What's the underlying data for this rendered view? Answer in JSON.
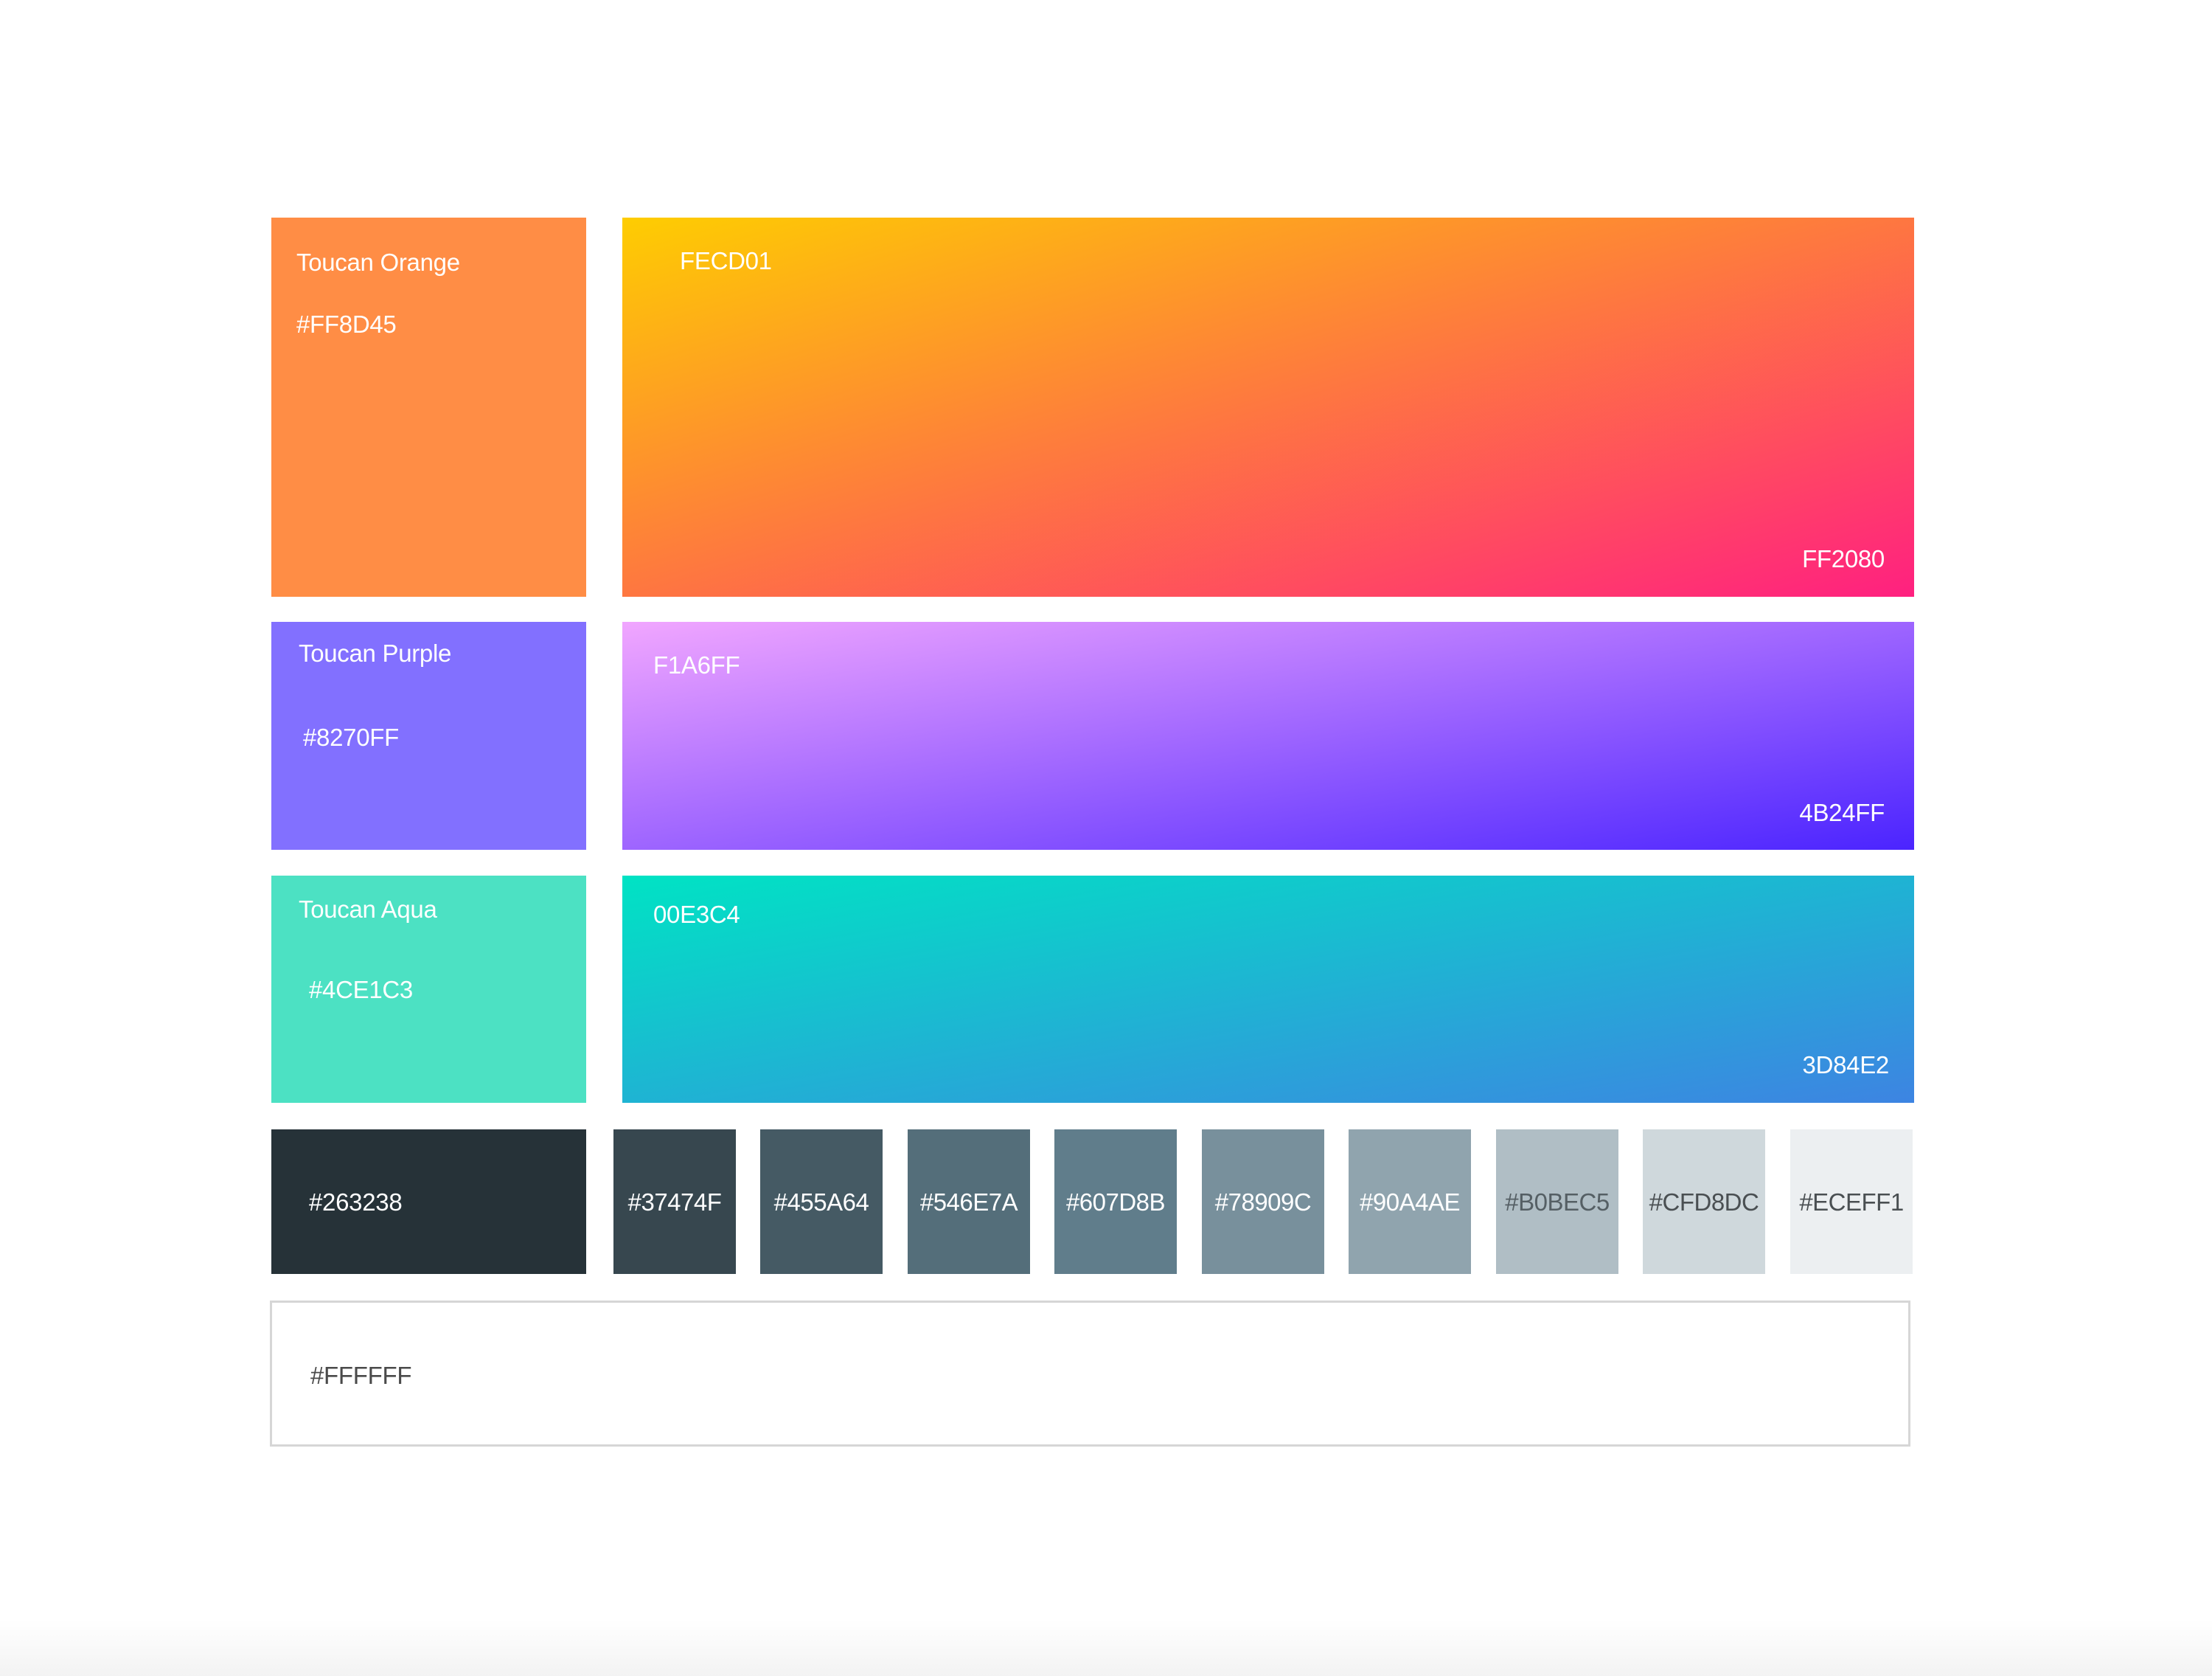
{
  "brand_colors": [
    {
      "name": "Toucan Orange",
      "hex": "#FF8D45",
      "color": "#FF8D45"
    },
    {
      "name": "Toucan Purple",
      "hex": "#8270FF",
      "color": "#8270FF"
    },
    {
      "name": "Toucan Aqua",
      "hex": "#4CE1C3",
      "color": "#4CE1C3"
    }
  ],
  "gradients": [
    {
      "start_label": "FECD01",
      "end_label": "FF2080",
      "start_color": "#FECD01",
      "end_color": "#FF2080"
    },
    {
      "start_label": "F1A6FF",
      "end_label": "4B24FF",
      "start_color": "#F1A6FF",
      "end_color": "#4B24FF"
    },
    {
      "start_label": "00E3C4",
      "end_label": "3D84E2",
      "start_color": "#00E3C4",
      "end_color": "#3D84E2"
    }
  ],
  "grays": [
    {
      "label": "#263238",
      "color": "#263238",
      "text_color": "#FFFFFF"
    },
    {
      "label": "#37474F",
      "color": "#37474F",
      "text_color": "#FFFFFF"
    },
    {
      "label": "#455A64",
      "color": "#455A64",
      "text_color": "#FFFFFF"
    },
    {
      "label": "#546E7A",
      "color": "#546E7A",
      "text_color": "#FFFFFF"
    },
    {
      "label": "#607D8B",
      "color": "#607D8B",
      "text_color": "#FFFFFF"
    },
    {
      "label": "#78909C",
      "color": "#78909C",
      "text_color": "#FFFFFF"
    },
    {
      "label": "#90A4AE",
      "color": "#90A4AE",
      "text_color": "#FFFFFF"
    },
    {
      "label": "#B0BEC5",
      "color": "#B0BEC5",
      "text_color": "#555F64"
    },
    {
      "label": "#CFD8DC",
      "color": "#CFD8DC",
      "text_color": "#4A4F52"
    },
    {
      "label": "#ECEFF1",
      "color": "#ECEFF1",
      "text_color": "#4A4F52"
    }
  ],
  "white": {
    "label": "#FFFFFF",
    "color": "#FFFFFF",
    "text_color": "#4A4A4A"
  }
}
